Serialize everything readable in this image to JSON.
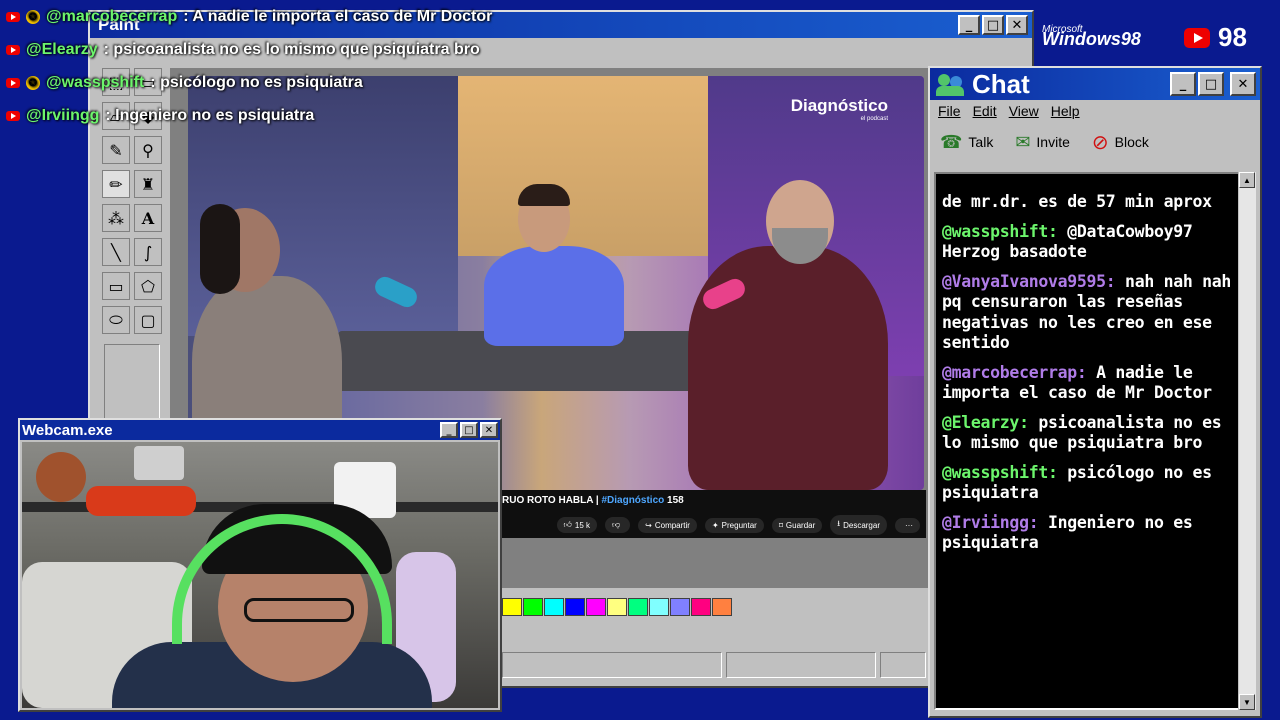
{
  "overlay_chat": [
    {
      "user": "@marcobecerrap",
      "text": ": A nadie le importa el caso de Mr Doctor",
      "badge": true
    },
    {
      "user": "@Elearzy",
      "text": ": psicoanalista no es lo mismo que psiquiatra bro",
      "badge": false
    },
    {
      "user": "@wasspshift",
      "text": ": psicólogo no es psiquiatra",
      "badge": true
    },
    {
      "user": "@Irviingg",
      "text": ": Ingeniero no es psiquiatra",
      "badge": false
    }
  ],
  "paint": {
    "title": "Paint"
  },
  "video": {
    "logo": "Diagnóstico",
    "logo_sub": "el podcast",
    "caption_prefix": "RUO ROTO HABLA | ",
    "caption_tag": "#Diagnóstico",
    "caption_num": " 158",
    "actions": [
      {
        "icon": "thumbs-up-icon",
        "label": "15 k"
      },
      {
        "icon": "thumbs-down-icon",
        "label": ""
      },
      {
        "icon": "share-icon",
        "label": "Compartir"
      },
      {
        "icon": "ask-icon",
        "label": "Preguntar"
      },
      {
        "icon": "bookmark-icon",
        "label": "Guardar"
      },
      {
        "icon": "download-icon",
        "label": "Descargar"
      },
      {
        "icon": "more-icon",
        "label": "···"
      }
    ]
  },
  "palette": [
    "#ffff00",
    "#00ff00",
    "#00ffff",
    "#0000ff",
    "#ff00ff",
    "#ffff80",
    "#00ff80",
    "#80ffff",
    "#8080ff",
    "#ff0080",
    "#ff8040"
  ],
  "webcam": {
    "title": "Webcam.exe"
  },
  "chat": {
    "title": "Chat",
    "menu": [
      "File",
      "Edit",
      "View",
      "Help"
    ],
    "toolbar": [
      "Talk",
      "Invite",
      "Block"
    ],
    "messages": [
      {
        "user": "",
        "text": "de mr.dr. es de 57 min aprox",
        "color": "green"
      },
      {
        "user": "@wasspshift:",
        "text": " @DataCowboy97 Herzog basadote",
        "color": "green"
      },
      {
        "user": "@VanyaIvanova9595:",
        "text": " nah nah nah pq censuraron las reseñas negativas no les creo en ese sentido",
        "color": "purple"
      },
      {
        "user": "@marcobecerrap:",
        "text": " A nadie le importa el caso de Mr Doctor",
        "color": "purple"
      },
      {
        "user": "@Elearzy:",
        "text": " psicoanalista no es lo mismo que psiquiatra bro",
        "color": "green"
      },
      {
        "user": "@wasspshift:",
        "text": " psicólogo no es psiquiatra",
        "color": "green"
      },
      {
        "user": "@Irviingg:",
        "text": " Ingeniero no es psiquiatra",
        "color": "purple"
      }
    ]
  },
  "branding": {
    "windows_small": "Microsoft",
    "windows": "Windows98",
    "yt_count": "98"
  }
}
